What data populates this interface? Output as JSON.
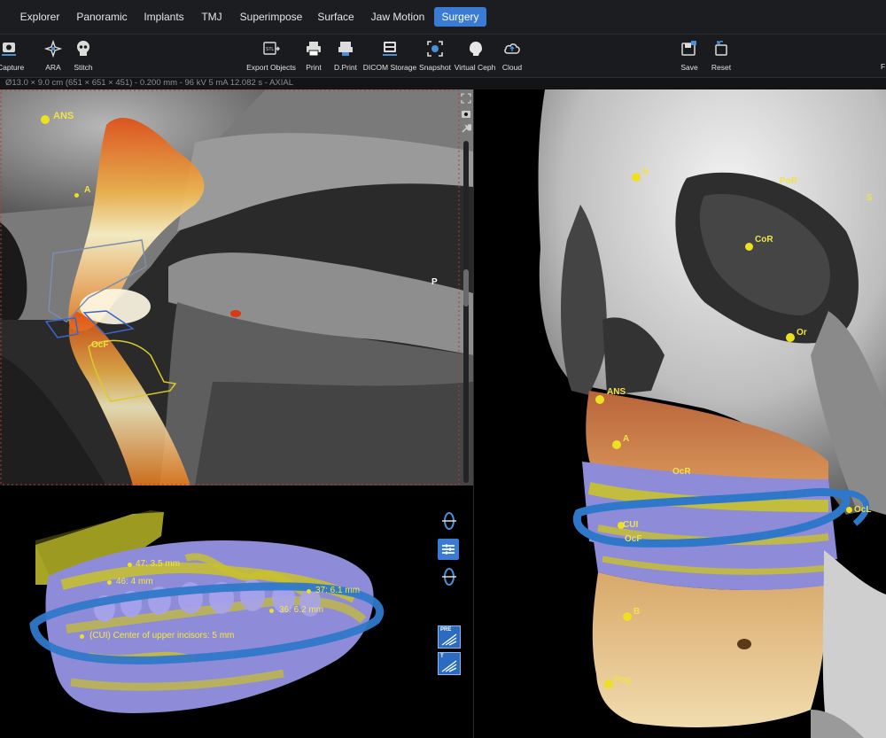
{
  "menu": {
    "tabs": [
      "Explorer",
      "Panoramic",
      "Implants",
      "TMJ",
      "Superimpose",
      "Surface",
      "Jaw Motion",
      "Surgery"
    ],
    "active_tab": "Surgery"
  },
  "toolbar": {
    "left_tools": [
      {
        "label": "el Capture",
        "icon": "capture-icon"
      },
      {
        "label": "ARA",
        "icon": "ara-icon"
      },
      {
        "label": "Stitch",
        "icon": "stitch-icon"
      }
    ],
    "center_tools": [
      {
        "label": "Export Objects",
        "icon": "export-objects-icon"
      },
      {
        "label": "Print",
        "icon": "print-icon"
      },
      {
        "label": "D.Print",
        "icon": "dprint-icon"
      },
      {
        "label": "DICOM Storage",
        "icon": "dicom-storage-icon"
      },
      {
        "label": "Snapshot",
        "icon": "snapshot-icon"
      },
      {
        "label": "Virtual Ceph",
        "icon": "virtual-ceph-icon"
      },
      {
        "label": "Cloud",
        "icon": "cloud-icon"
      }
    ],
    "right_tools": [
      {
        "label": "Save",
        "icon": "save-icon"
      },
      {
        "label": "Reset",
        "icon": "reset-icon"
      }
    ],
    "edge_label": "F"
  },
  "info_bar": "Ø13.0 × 9.0 cm (651 × 651 × 451) - 0.200 mm - 96 kV 5 mA 12.082 s - AXIAL",
  "slice_view": {
    "orientation_marker": "P",
    "landmarks": [
      "ANS",
      "A",
      "OcF"
    ]
  },
  "model_view": {
    "measurements": [
      "47: 3.5 mm",
      "46: 4 mm",
      "37: 6.1 mm",
      "36: 6.2 mm",
      "(CUI) Center of upper incisors: 5 mm"
    ],
    "buttons": [
      "PRE",
      "T"
    ]
  },
  "skull_view": {
    "landmarks": [
      "N",
      "PoR",
      "S",
      "CoR",
      "Or",
      "ANS",
      "A",
      "OcR",
      "CUI",
      "OcF",
      "OcL",
      "B",
      "Pog"
    ]
  },
  "colors": {
    "active_tab": "#3a7bd5",
    "landmark": "#ece021",
    "occlusal_plane": "#2f78c9",
    "model_violet": "#8e8bd8",
    "model_yellow": "#c9c22c"
  }
}
